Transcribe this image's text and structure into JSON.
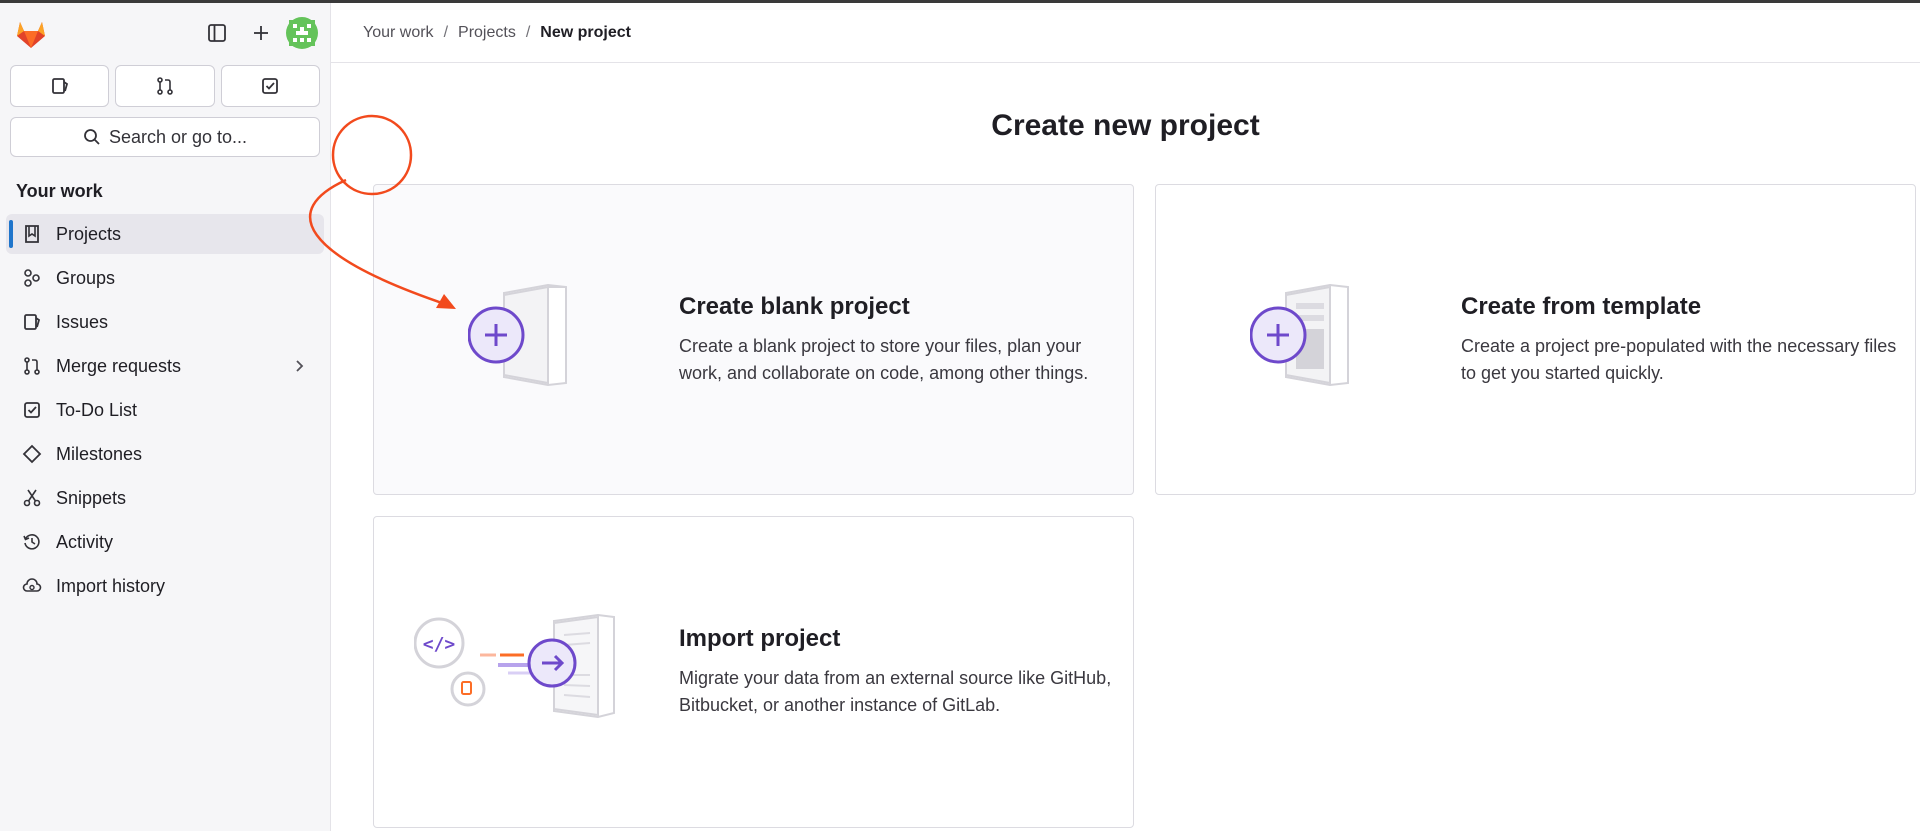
{
  "sidebar": {
    "quick_actions": [
      "issues",
      "merge-requests",
      "todos"
    ],
    "search_placeholder": "Search or go to...",
    "section_title": "Your work",
    "items": [
      {
        "label": "Projects",
        "icon": "project-icon",
        "active": true
      },
      {
        "label": "Groups",
        "icon": "group-icon"
      },
      {
        "label": "Issues",
        "icon": "issues-icon"
      },
      {
        "label": "Merge requests",
        "icon": "merge-request-icon",
        "has_chevron": true
      },
      {
        "label": "To-Do List",
        "icon": "todo-icon"
      },
      {
        "label": "Milestones",
        "icon": "milestone-icon"
      },
      {
        "label": "Snippets",
        "icon": "snippet-icon"
      },
      {
        "label": "Activity",
        "icon": "history-icon"
      },
      {
        "label": "Import history",
        "icon": "import-history-icon"
      }
    ]
  },
  "breadcrumb": {
    "items": [
      "Your work",
      "Projects"
    ],
    "current": "New project",
    "separator": "/"
  },
  "page": {
    "title": "Create new project"
  },
  "cards": {
    "blank": {
      "title": "Create blank project",
      "description": "Create a blank project to store your files, plan your work, and collaborate on code, among other things."
    },
    "template": {
      "title": "Create from template",
      "description": "Create a project pre-populated with the necessary files to get you started quickly."
    },
    "import": {
      "title": "Import project",
      "description": "Migrate your data from an external source like GitHub, Bitbucket, or another instance of GitLab."
    }
  },
  "colors": {
    "accent": "#6e49cb",
    "annotation": "#f24a1d",
    "active_indicator": "#1f75cb"
  }
}
